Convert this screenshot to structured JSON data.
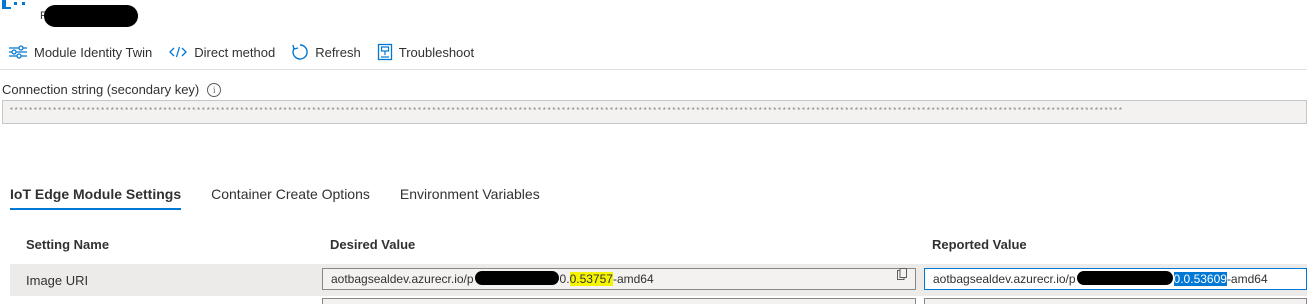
{
  "header": {
    "title_prefix": "P",
    "logo_icon": "azure-iot-edge-icon"
  },
  "toolbar": {
    "items": [
      {
        "label": "Module Identity Twin",
        "icon": "settings-sliders-icon"
      },
      {
        "label": "Direct method",
        "icon": "code-icon"
      },
      {
        "label": "Refresh",
        "icon": "refresh-icon"
      },
      {
        "label": "Troubleshoot",
        "icon": "troubleshoot-icon"
      }
    ]
  },
  "connection": {
    "label": "Connection string (secondary key)",
    "value": "****************************************************************************************************************************************************************************************************************************************"
  },
  "tabs": [
    {
      "label": "IoT Edge Module Settings",
      "active": true
    },
    {
      "label": "Container Create Options",
      "active": false
    },
    {
      "label": "Environment Variables",
      "active": false
    }
  ],
  "table": {
    "headers": {
      "setting_name": "Setting Name",
      "desired_value": "Desired Value",
      "reported_value": "Reported Value"
    },
    "rows": [
      {
        "setting_name": "Image URI",
        "desired": {
          "prefix": "aotbagsealdev.azurecr.io/p",
          "pre_highlight": "0.",
          "highlight": "0.53757",
          "suffix": "-amd64"
        },
        "reported": {
          "prefix": "aotbagsealdev.azurecr.io/p",
          "highlight": "0.0.53609",
          "suffix": "-amd64"
        }
      }
    ]
  },
  "colors": {
    "accent": "#0078d4",
    "highlight_yellow": "#f5f500"
  }
}
